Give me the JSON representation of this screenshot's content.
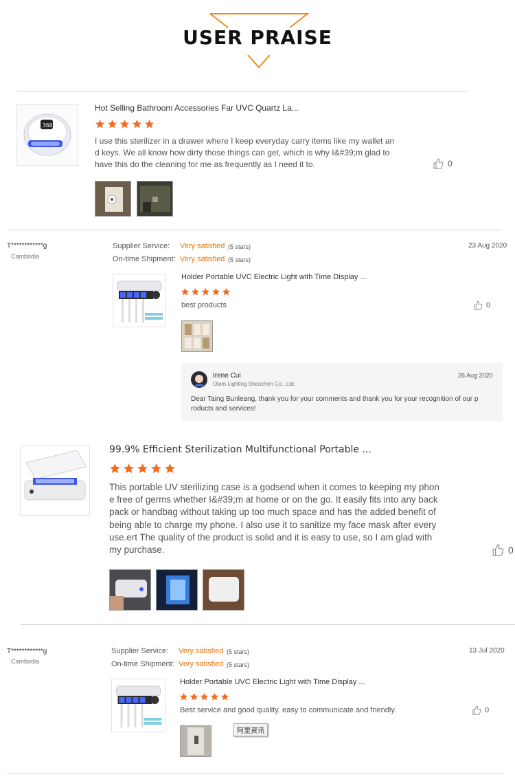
{
  "header": {
    "title": "USER PRAISE",
    "accent": "#f08b1d"
  },
  "colors": {
    "star": "#f26b1f",
    "link_orange": "#e8740c",
    "divider": "#d6d6d6"
  },
  "review1": {
    "product_title": "Hot Selling Bathroom Accessories Far UVC Quartz La...",
    "rating": 5,
    "lines": [
      "I use this sterilizer in a drawer where I keep everyday carry items like my wallet an",
      "d keys. We all know how dirty those things can get, which is why I&#39;m glad to",
      "have this do the cleaning for me as frequently as I need it to."
    ],
    "likes": "0",
    "product_icon": "round-uvc-sterilizer-image",
    "photo_icons": [
      "wall-mounted-sterilizer-photo",
      "dark-drawer-photo"
    ]
  },
  "review2": {
    "buyer": "T************g",
    "country": "Cambodia",
    "supplier_label": "Supplier Service:",
    "supplier_value": "Very satisfied",
    "supplier_stars": "(5 stars)",
    "shipment_label": "On-time Shipment:",
    "shipment_value": "Very satisfied",
    "shipment_stars": "(5 stars)",
    "date": "23 Aug 2020",
    "product_title": "Holder Portable UVC Electric Light with Time Display ...",
    "rating": 5,
    "comment": "best products",
    "likes": "0",
    "product_icon": "toothbrush-holder-sterilizer-image",
    "photo_icons": [
      "box-shelf-photo"
    ],
    "reply": {
      "name": "Irene Cui",
      "company": "Olam Lighting Shenzhen Co., Ltd.",
      "date": "26 Aug 2020",
      "lines": [
        "Dear Taing Bunleang, thank you for your comments and thank you for your recognition of our p",
        "roducts and services!"
      ]
    }
  },
  "review3": {
    "product_title": "99.9% Efficient Sterilization Multifunctional Portable ...",
    "rating": 5,
    "lines": [
      "This portable UV sterilizing case is a godsend when it comes to keeping my phon",
      "e free of germs whether I&#39;m at home or on the go. It easily fits into any back",
      "pack or handbag without taking up too much space and has the added benefit of",
      "being able to charge my phone. I also use it to sanitize my face mask after every",
      "use.ert The quality of the product is solid and it is easy to use, so I am glad with",
      "my purchase."
    ],
    "likes": "0",
    "product_icon": "uv-sterilizer-box-image",
    "photo_icons": [
      "sterilizer-box-hand-photo",
      "blue-light-photo",
      "white-box-photo"
    ]
  },
  "review4": {
    "buyer": "T************g",
    "country": "Cambodia",
    "supplier_label": "Supplier Service:",
    "supplier_value": "Very satisfied",
    "supplier_stars": "(5 stars)",
    "shipment_label": "On-time Shipment:",
    "shipment_value": "Very satisfied",
    "shipment_stars": "(5 stars)",
    "date": "13 Jul 2020",
    "product_title": "Holder Portable UVC Electric Light with Time Display ...",
    "rating": 5,
    "comment": "Best service and good quality. easy to communicate and friendly.",
    "likes": "0",
    "product_icon": "toothbrush-holder-sterilizer-image",
    "photo_icons": [
      "bathroom-door-photo"
    ],
    "tooltip": "阿里资讯"
  }
}
